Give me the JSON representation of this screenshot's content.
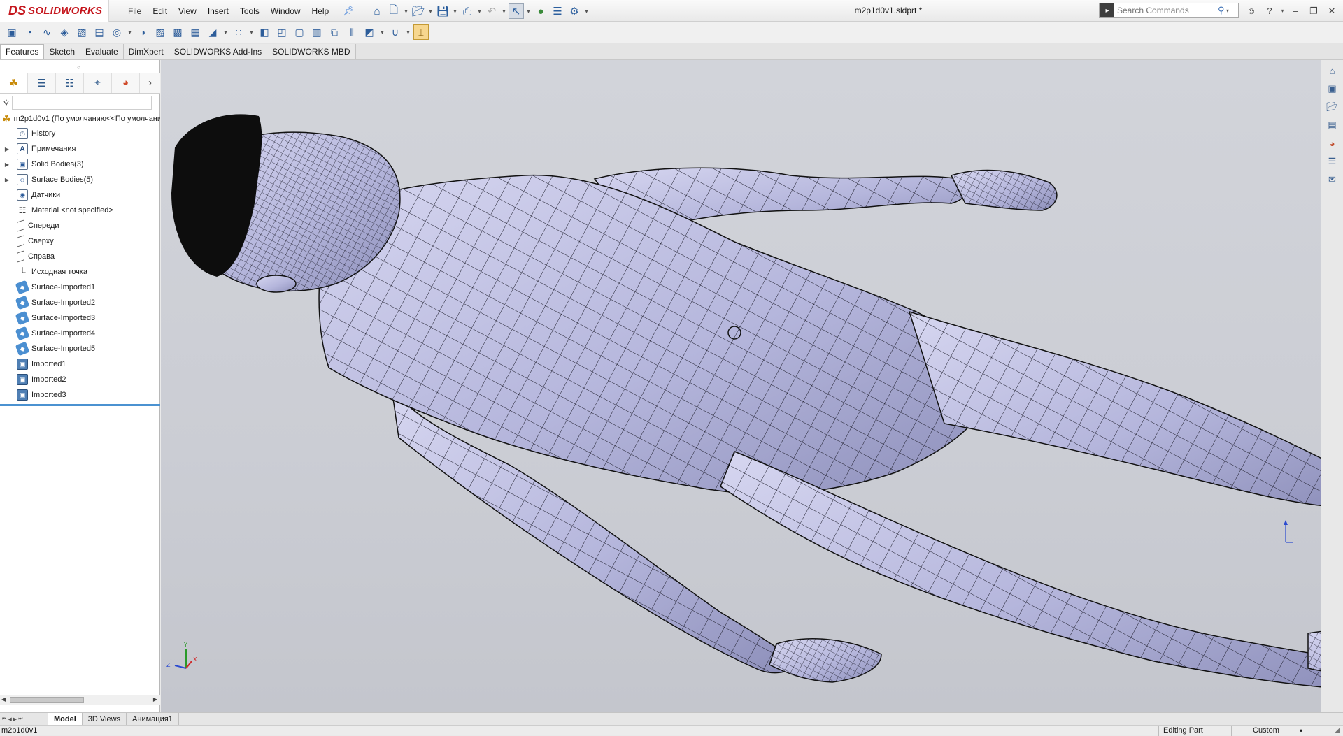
{
  "app": {
    "logo_ds": "DS",
    "logo_brand": "SOLIDWORKS",
    "document_title": "m2p1d0v1.sldprt *"
  },
  "menu": [
    "File",
    "Edit",
    "View",
    "Insert",
    "Tools",
    "Window",
    "Help"
  ],
  "search": {
    "placeholder": "Search Commands"
  },
  "command_tabs": [
    {
      "label": "Features",
      "active": true
    },
    {
      "label": "Sketch",
      "active": false
    },
    {
      "label": "Evaluate",
      "active": false
    },
    {
      "label": "DimXpert",
      "active": false
    },
    {
      "label": "SOLIDWORKS Add-Ins",
      "active": false
    },
    {
      "label": "SOLIDWORKS MBD",
      "active": false
    }
  ],
  "feature_tree": {
    "root": "m2p1d0v1  (По умолчанию<<По умолчани",
    "items": [
      {
        "label": "History",
        "icon": "history-icon",
        "expandable": false
      },
      {
        "label": "Примечания",
        "icon": "annotations-icon",
        "expandable": true
      },
      {
        "label": "Solid Bodies(3)",
        "icon": "solid-bodies-icon",
        "expandable": true
      },
      {
        "label": "Surface Bodies(5)",
        "icon": "surface-bodies-icon",
        "expandable": true
      },
      {
        "label": "Датчики",
        "icon": "sensors-icon",
        "expandable": false
      },
      {
        "label": "Material <not specified>",
        "icon": "material-icon",
        "expandable": false
      },
      {
        "label": "Спереди",
        "icon": "plane-icon",
        "expandable": false
      },
      {
        "label": "Сверху",
        "icon": "plane-icon",
        "expandable": false
      },
      {
        "label": "Справа",
        "icon": "plane-icon",
        "expandable": false
      },
      {
        "label": "Исходная точка",
        "icon": "origin-icon",
        "expandable": false
      },
      {
        "label": "Surface-Imported1",
        "icon": "surface-imported-icon",
        "expandable": false
      },
      {
        "label": "Surface-Imported2",
        "icon": "surface-imported-icon",
        "expandable": false
      },
      {
        "label": "Surface-Imported3",
        "icon": "surface-imported-icon",
        "expandable": false
      },
      {
        "label": "Surface-Imported4",
        "icon": "surface-imported-icon",
        "expandable": false
      },
      {
        "label": "Surface-Imported5",
        "icon": "surface-imported-icon",
        "expandable": false
      },
      {
        "label": "Imported1",
        "icon": "imported-body-icon",
        "expandable": false
      },
      {
        "label": "Imported2",
        "icon": "imported-body-icon",
        "expandable": false
      },
      {
        "label": "Imported3",
        "icon": "imported-body-icon",
        "expandable": false
      }
    ]
  },
  "bottom_tabs": [
    {
      "label": "Model",
      "active": true
    },
    {
      "label": "3D Views",
      "active": false
    },
    {
      "label": "Анимация1",
      "active": false
    }
  ],
  "status": {
    "file": "m2p1d0v1",
    "mode": "Editing Part",
    "units": "Custom"
  },
  "triad": {
    "x": "X",
    "y": "Y",
    "z": "Z"
  },
  "colors": {
    "brand": "#c5161d",
    "model_surface": "#b7b8dd",
    "viewport_bg": "#cbcdd4",
    "rollback_bar": "#4b92d1"
  }
}
